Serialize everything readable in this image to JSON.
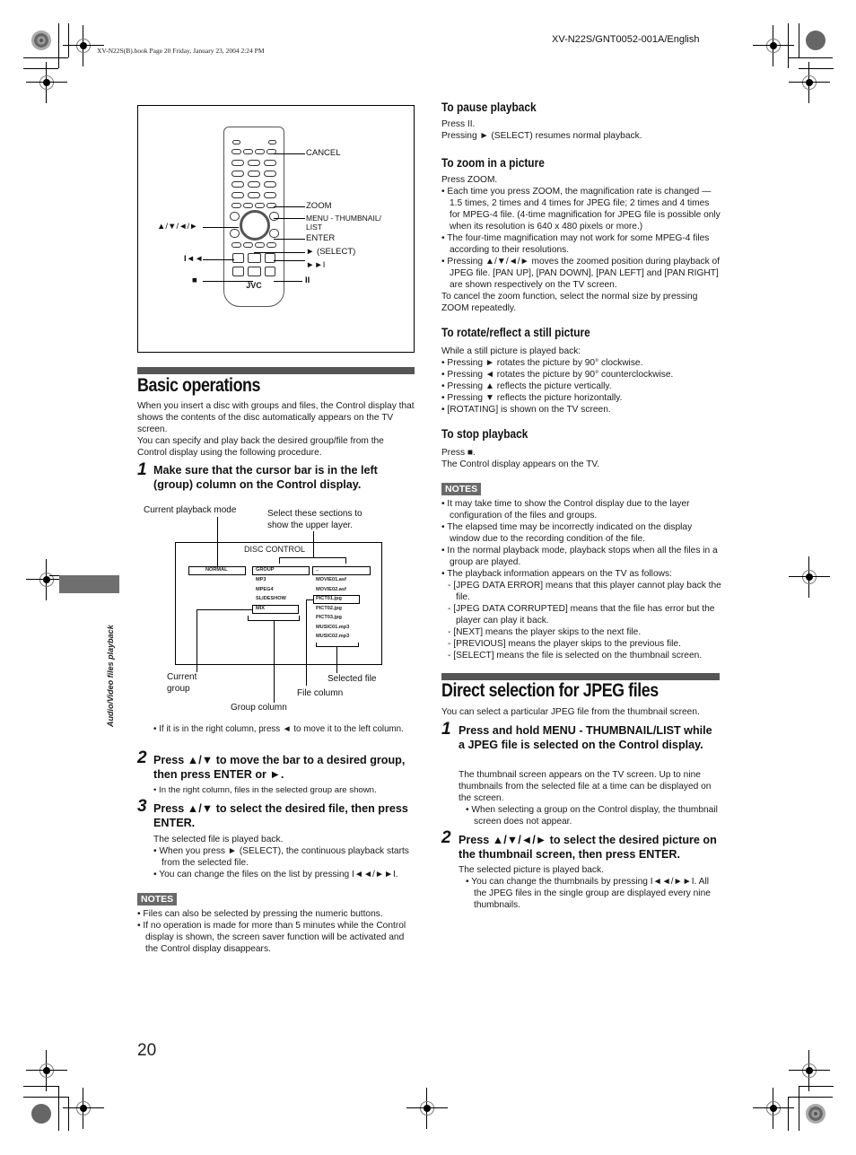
{
  "header": {
    "book_line": "XV-N22S(B).book  Page 20  Friday, January 23, 2004  2:24 PM",
    "doc_code": "XV-N22S/GNT0052-001A/English"
  },
  "side_tab": {
    "label": "Audio/Video files playback"
  },
  "remote_figure": {
    "brand": "JVC",
    "labels": {
      "cancel": "CANCEL",
      "zoom": "ZOOM",
      "menu": "MENU - THUMBNAIL/",
      "menu2": "LIST",
      "enter": "ENTER",
      "select": "► (SELECT)",
      "next": "►►I",
      "pause": "II",
      "arrows": "▲/▼/◄/►",
      "prev": "I◄◄",
      "stop": "■"
    }
  },
  "basic_operations": {
    "title": "Basic operations",
    "intro": [
      "When you insert a disc with groups and files, the Control display that shows the contents of the disc automatically appears on the TV screen.",
      "You can specify and play back the desired group/file from the Control display using the following procedure."
    ],
    "step1": {
      "num": "1",
      "text": "Make sure that the cursor bar is in the left (group) column on the Control display."
    },
    "diagram": {
      "title": "DISC CONTROL",
      "mode": "NORMAL",
      "groups": [
        "GROUP",
        "MP3",
        "MPEG4",
        "SLIDESHOW",
        "MIX"
      ],
      "files": [
        "..",
        "MOVIE01.asf",
        "MOVIE02.asf",
        "PICT01.jpg",
        "PICT02.jpg",
        "PICT03.jpg",
        "MUSIC01.mp3",
        "MUSIC02.mp3"
      ],
      "callouts": {
        "playback_mode": "Current playback mode",
        "upper_layer": "Select these sections to show the upper layer.",
        "current_group": "Current group",
        "group_column": "Group column",
        "file_column": "File column",
        "selected_file": "Selected file"
      }
    },
    "step1_bullet": "If it is in the right column, press ◄ to move it to the left column.",
    "step2": {
      "num": "2",
      "text": "Press ▲/▼ to move the bar to a desired group, then press ENTER or ►.",
      "bullet": "In the right column, files in the selected group are shown."
    },
    "step3": {
      "num": "3",
      "text": "Press ▲/▼ to select the desired file, then press ENTER.",
      "body": "The selected file is played back.",
      "bullets": [
        "When you press ► (SELECT), the continuous playback starts from the selected file.",
        "You can change the files on the list by pressing I◄◄/►►I."
      ]
    },
    "notes": {
      "label": "NOTES",
      "items": [
        "Files can also be selected by pressing the numeric buttons.",
        "If no operation is made for more than 5 minutes while the Control display is shown, the screen saver function will be activated and the Control display disappears."
      ]
    }
  },
  "pause": {
    "title": "To pause playback",
    "lines": [
      "Press II.",
      "Pressing ► (SELECT) resumes normal playback."
    ]
  },
  "zoom": {
    "title": "To zoom in a picture",
    "intro": "Press ZOOM.",
    "bullets": [
      "Each time you press ZOOM, the magnification rate is changed — 1.5 times, 2 times and 4 times for JPEG file; 2 times and 4 times for MPEG-4 file. (4-time magnification for JPEG file is possible only when its resolution is 640 x 480 pixels or more.)",
      "The four-time magnification may not work for some MPEG-4 files according to their resolutions.",
      "Pressing ▲/▼/◄/► moves the zoomed position during playback of JPEG file. [PAN UP], [PAN DOWN], [PAN LEFT] and [PAN RIGHT] are shown respectively on the TV screen."
    ],
    "outro": "To cancel the zoom function, select the normal size by pressing ZOOM repeatedly."
  },
  "rotate": {
    "title": "To rotate/reflect a still picture",
    "intro": "While a still picture is played back:",
    "bullets": [
      "Pressing ► rotates the picture by 90° clockwise.",
      "Pressing ◄ rotates the picture by 90° counterclockwise.",
      "Pressing ▲ reflects the picture vertically.",
      "Pressing ▼ reflects the picture horizontally.",
      "[ROTATING] is shown on the TV screen."
    ]
  },
  "stop": {
    "title": "To stop playback",
    "lines": [
      "Press ■.",
      "The Control display appears on the TV."
    ]
  },
  "right_notes": {
    "label": "NOTES",
    "items": [
      "It may take time to show the Control display due to the layer configuration of the files and groups.",
      "The elapsed time may be incorrectly indicated on the display window due to the recording condition of the file.",
      "In the normal playback mode, playback stops when all the files in a group are played.",
      "The playback information appears on the TV as follows:"
    ],
    "sub_items": [
      "[JPEG DATA ERROR] means that this player cannot play back the file.",
      "[JPEG DATA CORRUPTED] means that the file has error but the player can play it back.",
      "[NEXT] means the player skips to the next file.",
      "[PREVIOUS] means the player skips to the previous file.",
      "[SELECT] means the file is selected on the thumbnail screen."
    ]
  },
  "direct_selection": {
    "title": "Direct selection for JPEG files",
    "intro": "You can select a particular JPEG file from the thumbnail screen.",
    "step1": {
      "num": "1",
      "text": "Press and hold MENU - THUMBNAIL/LIST while a JPEG file is selected on the Control display.",
      "body": "The thumbnail screen appears on the TV screen. Up to nine thumbnails from the selected file at a time can be displayed on the screen.",
      "bullet": "When selecting a group on the Control display, the thumbnail screen does not appear."
    },
    "step2": {
      "num": "2",
      "text": "Press ▲/▼/◄/► to select the desired picture on the thumbnail screen, then press ENTER.",
      "body": "The selected picture is played back.",
      "bullet": "You can change the thumbnails by pressing I◄◄/►►I. All the JPEG files in the single group are displayed every nine thumbnails."
    }
  },
  "footer": {
    "page_number": "20"
  }
}
